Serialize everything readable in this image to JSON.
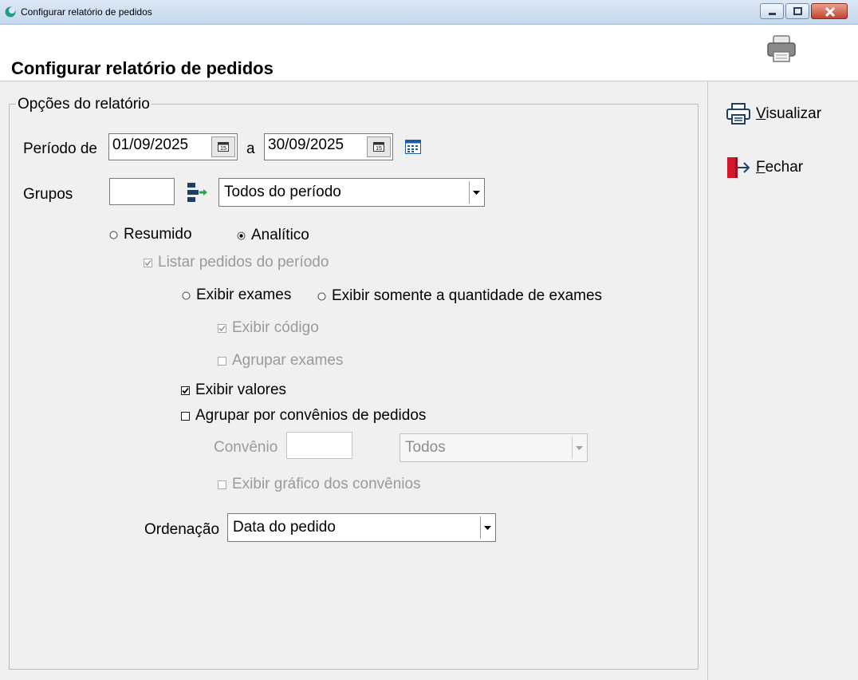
{
  "window": {
    "title": "Configurar relatório de pedidos"
  },
  "header": {
    "heading": "Configurar relatório de pedidos"
  },
  "sidebar": {
    "visualizar_prefix": "V",
    "visualizar_rest": "isualizar",
    "fechar_prefix": "F",
    "fechar_rest": "echar"
  },
  "group": {
    "title": "Opções do relatório"
  },
  "period": {
    "label": "Período de",
    "start": "01/09/2025",
    "separator": "a",
    "end": "30/09/2025"
  },
  "groups": {
    "label": "Grupos",
    "code": "",
    "selected": "Todos do período"
  },
  "mode": {
    "resumido": "Resumido",
    "analitico": "Analítico",
    "selected": "analitico"
  },
  "listar": {
    "label": "Listar pedidos do período",
    "checked": true,
    "enabled": false
  },
  "exams": {
    "exibir_exames": "Exibir exames",
    "exibir_quantidade": "Exibir somente a quantidade de exames",
    "exibir_codigo": {
      "label": "Exibir código",
      "checked": true,
      "enabled": false
    },
    "agrupar_exames": {
      "label": "Agrupar exames",
      "checked": false,
      "enabled": false
    }
  },
  "exibir_valores": {
    "label": "Exibir valores",
    "checked": true
  },
  "agrupar_convenios": {
    "label": "Agrupar por convênios de pedidos",
    "checked": false
  },
  "convenio": {
    "label": "Convênio",
    "code": "",
    "selected": "Todos"
  },
  "grafico_convenios": {
    "label": "Exibir gráfico dos convênios",
    "checked": false,
    "enabled": false
  },
  "ordenacao": {
    "label": "Ordenação",
    "selected": "Data do pedido"
  },
  "colors": {
    "accent": "#1e3f66",
    "green": "#2aa34a",
    "red": "#d5172c"
  }
}
